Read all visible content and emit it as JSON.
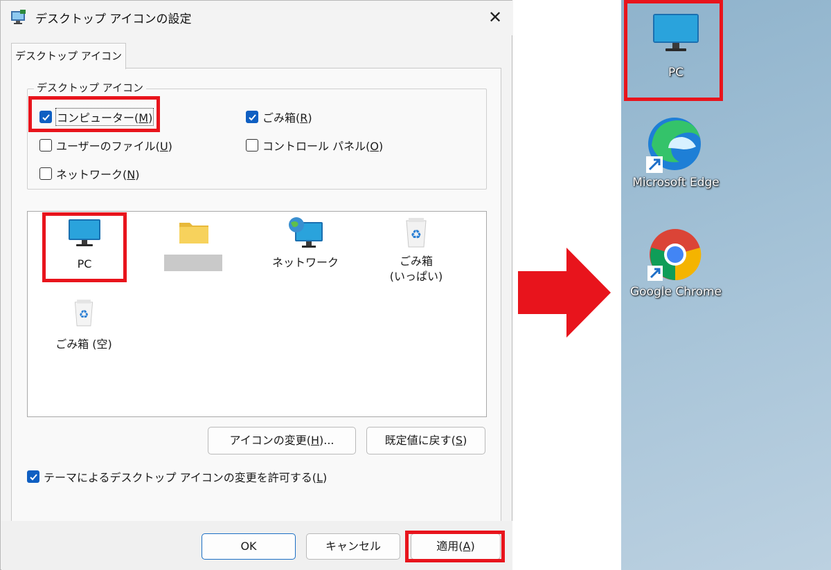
{
  "dialog": {
    "title": "デスクトップ アイコンの設定",
    "close_glyph": "✕",
    "tab_label": "デスクトップ アイコン",
    "group_label": "デスクトップ アイコン",
    "checkboxes": [
      {
        "label": "コンピューター(",
        "key": "M",
        "suffix": ")",
        "checked": true
      },
      {
        "label": "ごみ箱(",
        "key": "R",
        "suffix": ")",
        "checked": true
      },
      {
        "label": "ユーザーのファイル(",
        "key": "U",
        "suffix": ")",
        "checked": false
      },
      {
        "label": "コントロール パネル(",
        "key": "O",
        "suffix": ")",
        "checked": false
      },
      {
        "label": "ネットワーク(",
        "key": "N",
        "suffix": ")",
        "checked": false
      }
    ],
    "icon_list": [
      {
        "label": "PC",
        "icon": "monitor-icon"
      },
      {
        "label": "",
        "icon": "folder-icon"
      },
      {
        "label": "ネットワーク",
        "icon": "network-icon"
      },
      {
        "label": "ごみ箱\n(いっぱい)",
        "label_line1": "ごみ箱",
        "label_line2": "(いっぱい)",
        "icon": "recycle-bin-full-icon"
      },
      {
        "label": "ごみ箱 (空)",
        "icon": "recycle-bin-empty-icon"
      }
    ],
    "change_icon_button": {
      "label": "アイコンの変更(",
      "key": "H",
      "suffix": ")..."
    },
    "restore_default_button": {
      "label": "既定値に戻す(",
      "key": "S",
      "suffix": ")"
    },
    "theme_checkbox": {
      "label": "テーマによるデスクトップ アイコンの変更を許可する(",
      "key": "L",
      "suffix": ")",
      "checked": true
    },
    "ok_button": "OK",
    "cancel_button": "キャンセル",
    "apply_button": {
      "label": "適用(",
      "key": "A",
      "suffix": ")"
    }
  },
  "desktop": {
    "icons": [
      {
        "label": "PC",
        "icon": "monitor-icon"
      },
      {
        "label": "Microsoft Edge",
        "icon": "edge-icon"
      },
      {
        "label": "Google Chrome",
        "icon": "chrome-icon"
      }
    ]
  },
  "colors": {
    "highlight": "#e8141c",
    "checkbox": "#0f5fc2",
    "desktop_bg": "#a3c1d6"
  }
}
